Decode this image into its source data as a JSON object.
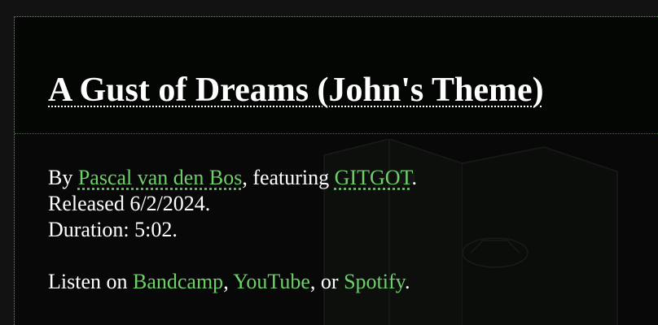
{
  "song": {
    "title": "A Gust of Dreams (John's Theme)"
  },
  "credits": {
    "by_prefix": "By ",
    "artist": "Pascal van den Bos",
    "featuring_prefix": ", featuring ",
    "featured": "GITGOT",
    "featured_suffix": ".",
    "released": "Released 6/2/2024.",
    "duration": "Duration: 5:02."
  },
  "listen": {
    "prefix": "Listen on ",
    "bandcamp": "Bandcamp",
    "sep1": ", ",
    "youtube": "YouTube",
    "sep2": ", or ",
    "spotify": "Spotify",
    "suffix": "."
  },
  "colors": {
    "background": "#121212",
    "panel": "#070807",
    "border": "#4caf50",
    "link": "#6fcf6a",
    "text": "#ffffff"
  }
}
